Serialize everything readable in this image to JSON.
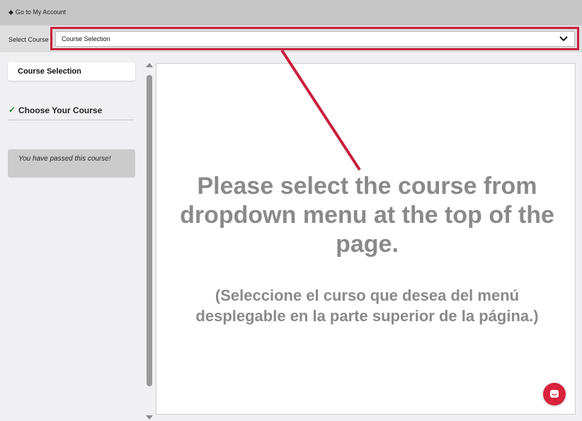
{
  "header": {
    "back_link": "Go to My Account",
    "back_icon": "diamond-icon"
  },
  "course_bar": {
    "label": "Select Course",
    "selected_value": "Course Selection",
    "dropdown_icon": "chevron-down-icon"
  },
  "sidebar": {
    "tab_label": "Course Selection",
    "choose_item": "Choose Your Course",
    "check_icon": "checkmark-icon",
    "passed_message": "You have passed this course!"
  },
  "content": {
    "message_en": "Please select the course from dropdown menu at the top of the page.",
    "message_es": "(Seleccione el curso que desea del menú desplegable en la parte superior de la página.)"
  },
  "chat": {
    "icon": "chat-bubble-icon"
  },
  "colors": {
    "highlight": "#c8203c",
    "chat_button": "#d8233b",
    "message_text": "#8a8a8a"
  }
}
